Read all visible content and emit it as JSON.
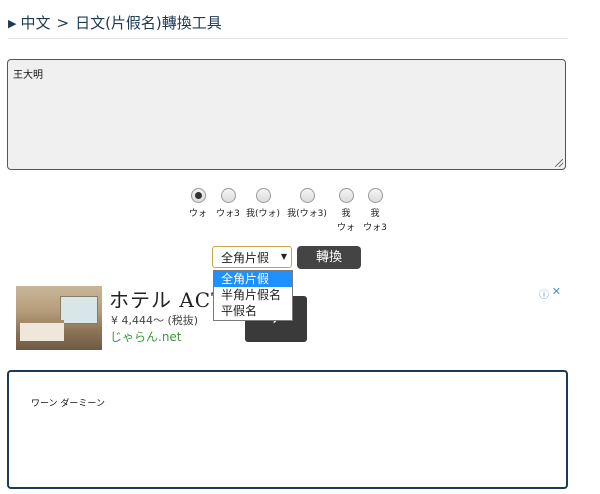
{
  "header": {
    "arrow": "▶",
    "from": "中文",
    "separator": ">",
    "to": "日文(片假名)轉換工具"
  },
  "input": {
    "value": "王大明"
  },
  "radio_options": [
    {
      "label": "ウォ",
      "checked": true
    },
    {
      "label": "ウォ3",
      "checked": false
    },
    {
      "label": "我(ウォ)",
      "checked": false
    },
    {
      "label": "我(ウォ3)",
      "checked": false
    },
    {
      "label": "我\nウォ",
      "checked": false
    },
    {
      "label": "我\nウォ3",
      "checked": false
    }
  ],
  "select": {
    "value": "全角片假",
    "options": [
      "全角片假",
      "半角片假名",
      "平假名"
    ]
  },
  "convert_button": {
    "label": "轉換"
  },
  "ad": {
    "title": "ホテル ACT",
    "price": "¥ 4,444～ (税抜)",
    "site": "じゃらん.net",
    "go": "›",
    "info_icon": "ⓘ",
    "close_icon": "✕"
  },
  "output": {
    "value": "ワーン ダーミーン"
  }
}
